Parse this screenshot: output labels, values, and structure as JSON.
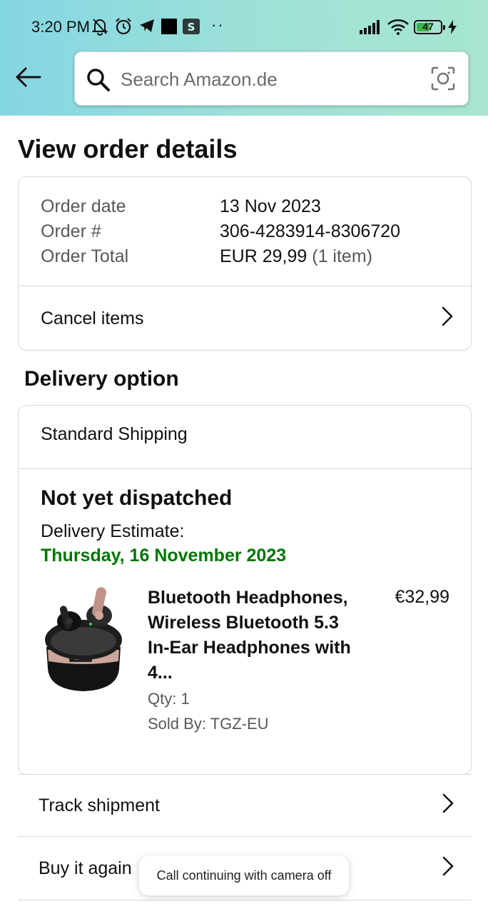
{
  "status_bar": {
    "time": "3:20 PM",
    "dots": "··",
    "battery": "47",
    "icons": [
      "mute-bell-icon",
      "alarm-icon",
      "telegram-icon",
      "black-square-app-icon",
      "s-app-icon",
      "signal-icon",
      "wifi-icon",
      "battery-icon",
      "charging-icon"
    ]
  },
  "header": {
    "search_placeholder": "Search Amazon.de",
    "colors": {
      "gradient_start": "#85d6e3",
      "gradient_end": "#a7e5d1"
    }
  },
  "page": {
    "title": "View order details"
  },
  "order_summary": {
    "rows": [
      {
        "label": "Order date",
        "value": "13 Nov 2023",
        "value_suffix": ""
      },
      {
        "label": "Order #",
        "value": "306-4283914-8306720",
        "value_suffix": ""
      },
      {
        "label": "Order Total",
        "value": "EUR 29,99",
        "value_suffix": "(1 item)"
      }
    ],
    "cancel_label": "Cancel items"
  },
  "delivery": {
    "section_title": "Delivery option",
    "shipping_method": "Standard Shipping",
    "status": "Not yet dispatched",
    "estimate_label": "Delivery Estimate:",
    "estimate_date": "Thursday, 16 November 2023",
    "estimate_color": "#007600",
    "item": {
      "title": "Bluetooth Headphones, Wireless Bluetooth 5.3 In-Ear Headphones with 4...",
      "price": "€32,99",
      "qty": "Qty: 1",
      "sold_by": "Sold By: TGZ-EU",
      "case_display": "100"
    }
  },
  "actions": [
    {
      "label": "Track shipment"
    },
    {
      "label": "Buy it again"
    }
  ],
  "toast": {
    "text": "Call continuing with camera off"
  }
}
